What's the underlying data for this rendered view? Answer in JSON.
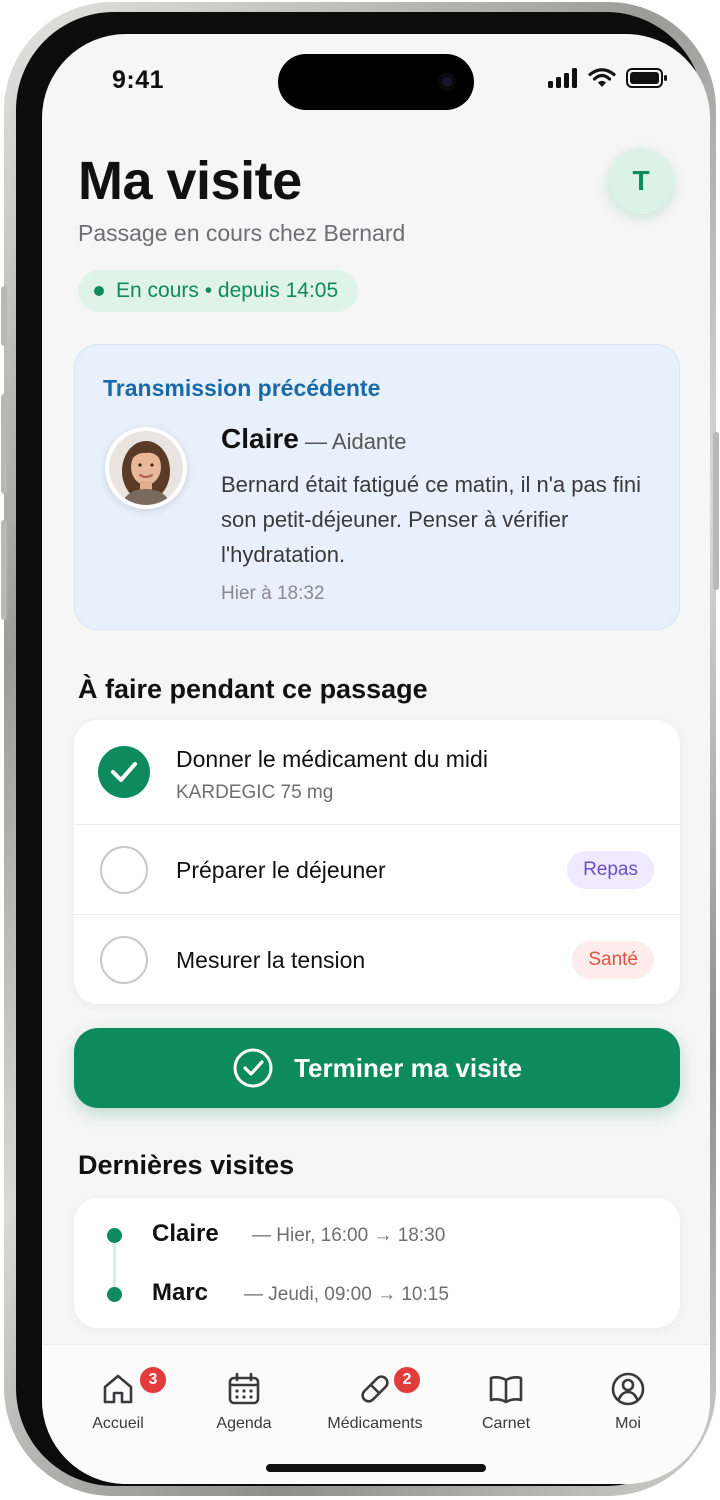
{
  "status_bar": {
    "time": "9:41"
  },
  "header": {
    "title": "Ma visite",
    "subtitle": "Passage en cours chez Bernard",
    "avatar_initial": "T"
  },
  "status_pill": {
    "text": "En cours • depuis 14:05"
  },
  "transmission": {
    "label": "Transmission précédente",
    "name": "Claire",
    "role": "— Aidante",
    "message": "Bernard était fatigué ce matin, il n'a pas fini son petit-déjeuner. Penser à vérifier l'hydratation.",
    "time": "Hier à 18:32"
  },
  "tasks_section": {
    "title": "À faire pendant ce passage",
    "items": [
      {
        "title": "Donner le médicament du midi",
        "subtitle": "KARDEGIC 75 mg",
        "done": true,
        "tag": ""
      },
      {
        "title": "Préparer le déjeuner",
        "subtitle": "",
        "done": false,
        "tag": "Repas"
      },
      {
        "title": "Mesurer la tension",
        "subtitle": "",
        "done": false,
        "tag": "Santé"
      }
    ]
  },
  "finish_button": {
    "label": "Terminer ma visite"
  },
  "history_section": {
    "title": "Dernières visites",
    "items": [
      {
        "name": "Claire",
        "meta": "— Hier, 16:00 → 18:30"
      },
      {
        "name": "Marc",
        "meta": "— Jeudi, 09:00 → 10:15"
      }
    ]
  },
  "tab_bar": {
    "tabs": [
      {
        "label": "Accueil",
        "icon": "home-icon",
        "badge": "3"
      },
      {
        "label": "Agenda",
        "icon": "calendar-icon",
        "badge": ""
      },
      {
        "label": "Médicaments",
        "icon": "pill-icon",
        "badge": "2"
      },
      {
        "label": "Carnet",
        "icon": "book-icon",
        "badge": ""
      },
      {
        "label": "Moi",
        "icon": "user-icon",
        "badge": ""
      }
    ]
  },
  "colors": {
    "accent": "#0e8a5f",
    "info": "#1a6aa8",
    "badge": "#e23b3b"
  }
}
